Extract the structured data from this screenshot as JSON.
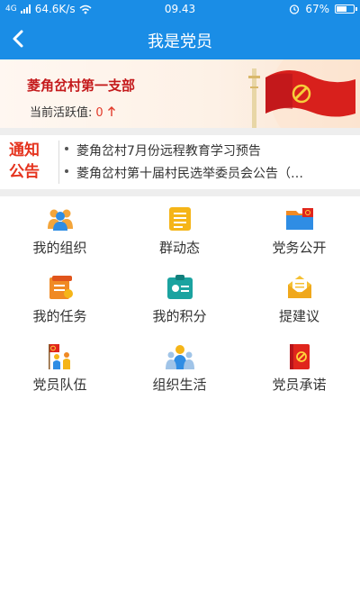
{
  "status_bar": {
    "network": "4G",
    "speed": "64.6K/s",
    "time": "09.43",
    "battery": "67%",
    "battery_level": 0.67
  },
  "header": {
    "back_icon": "chevron-left-icon",
    "title": "我是党员"
  },
  "banner": {
    "branch_name": "菱角岔村第一支部",
    "activity_label": "当前活跃值:",
    "activity_value": "0",
    "activity_trend_icon": "arrow-up-icon"
  },
  "notice": {
    "tag_line1": "通知",
    "tag_line2": "公告",
    "items": [
      "菱角岔村7月份远程教育学习预告",
      "菱角岔村第十届村民选举委员会公告（…"
    ]
  },
  "menu": [
    {
      "label": "我的组织",
      "icon": "organization-icon"
    },
    {
      "label": "群动态",
      "icon": "group-news-icon"
    },
    {
      "label": "党务公开",
      "icon": "party-affairs-folder-icon"
    },
    {
      "label": "我的任务",
      "icon": "task-icon"
    },
    {
      "label": "我的积分",
      "icon": "points-card-icon"
    },
    {
      "label": "提建议",
      "icon": "suggestion-envelope-icon"
    },
    {
      "label": "党员队伍",
      "icon": "party-members-icon"
    },
    {
      "label": "组织生活",
      "icon": "organization-life-icon"
    },
    {
      "label": "党员承诺",
      "icon": "party-promise-book-icon"
    }
  ],
  "colors": {
    "primary": "#1a8de6",
    "party_red": "#c4191b",
    "notice_red": "#e5331e"
  }
}
